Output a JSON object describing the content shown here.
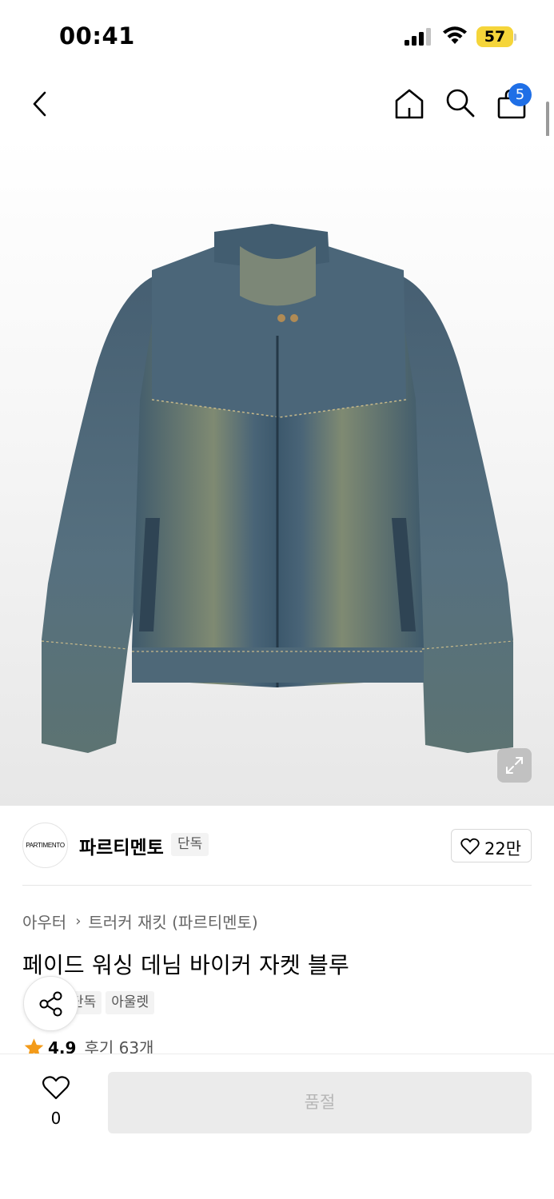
{
  "status": {
    "time": "00:41",
    "battery": "57"
  },
  "nav": {
    "cart_count": "5"
  },
  "brand": {
    "logo_text": "PARTIMENTO",
    "name": "파르티멘토",
    "tag": "단독",
    "like_count": "22만"
  },
  "product": {
    "breadcrumb": [
      "아우터",
      "트러커 재킷 (파르티멘토)"
    ],
    "title": "페이드 워싱 데님 바이커 자켓 블루",
    "tags": [
      "단독",
      "아울렛"
    ],
    "rating": "4.9",
    "reviews": "후기 63개"
  },
  "bottom": {
    "wish_count": "0",
    "buy_label": "품절"
  },
  "colors": {
    "accent": "#1f6fe6",
    "star": "#f39b1a",
    "battery": "#f5d53a",
    "denim": "#4a6478"
  }
}
